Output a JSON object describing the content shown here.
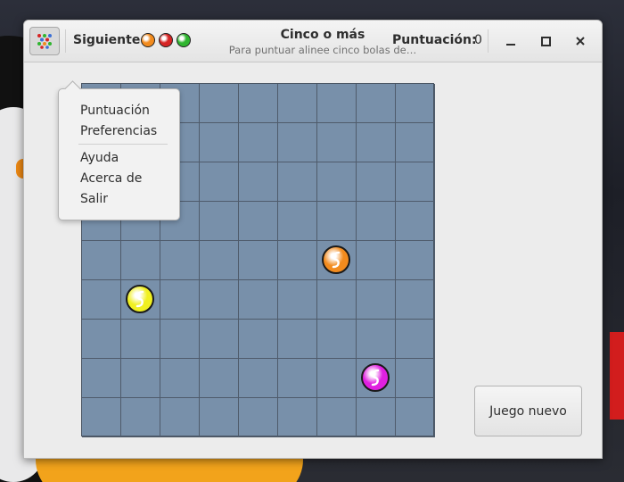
{
  "window": {
    "title": "Cinco o más",
    "subtitle": "Para puntuar alinee cinco bolas de…"
  },
  "header": {
    "next_label": "Siguiente:",
    "next_balls": [
      {
        "color": "#f28b1e",
        "name": "orange"
      },
      {
        "color": "#d62424",
        "name": "red"
      },
      {
        "color": "#2fb52f",
        "name": "green"
      }
    ],
    "score_label": "Puntuación:",
    "score_value": "0"
  },
  "menu": {
    "items": [
      "Puntuación",
      "Preferencias",
      "Ayuda",
      "Acerca de",
      "Salir"
    ]
  },
  "board": {
    "rows": 9,
    "cols": 9,
    "background": "#7890aa",
    "balls": [
      {
        "row": 4,
        "col": 6,
        "color": "#f28b1e",
        "name": "orange"
      },
      {
        "row": 5,
        "col": 1,
        "color": "#f0f020",
        "name": "yellow"
      },
      {
        "row": 7,
        "col": 7,
        "color": "#e020e0",
        "name": "magenta"
      }
    ]
  },
  "new_game_label": "Juego nuevo"
}
